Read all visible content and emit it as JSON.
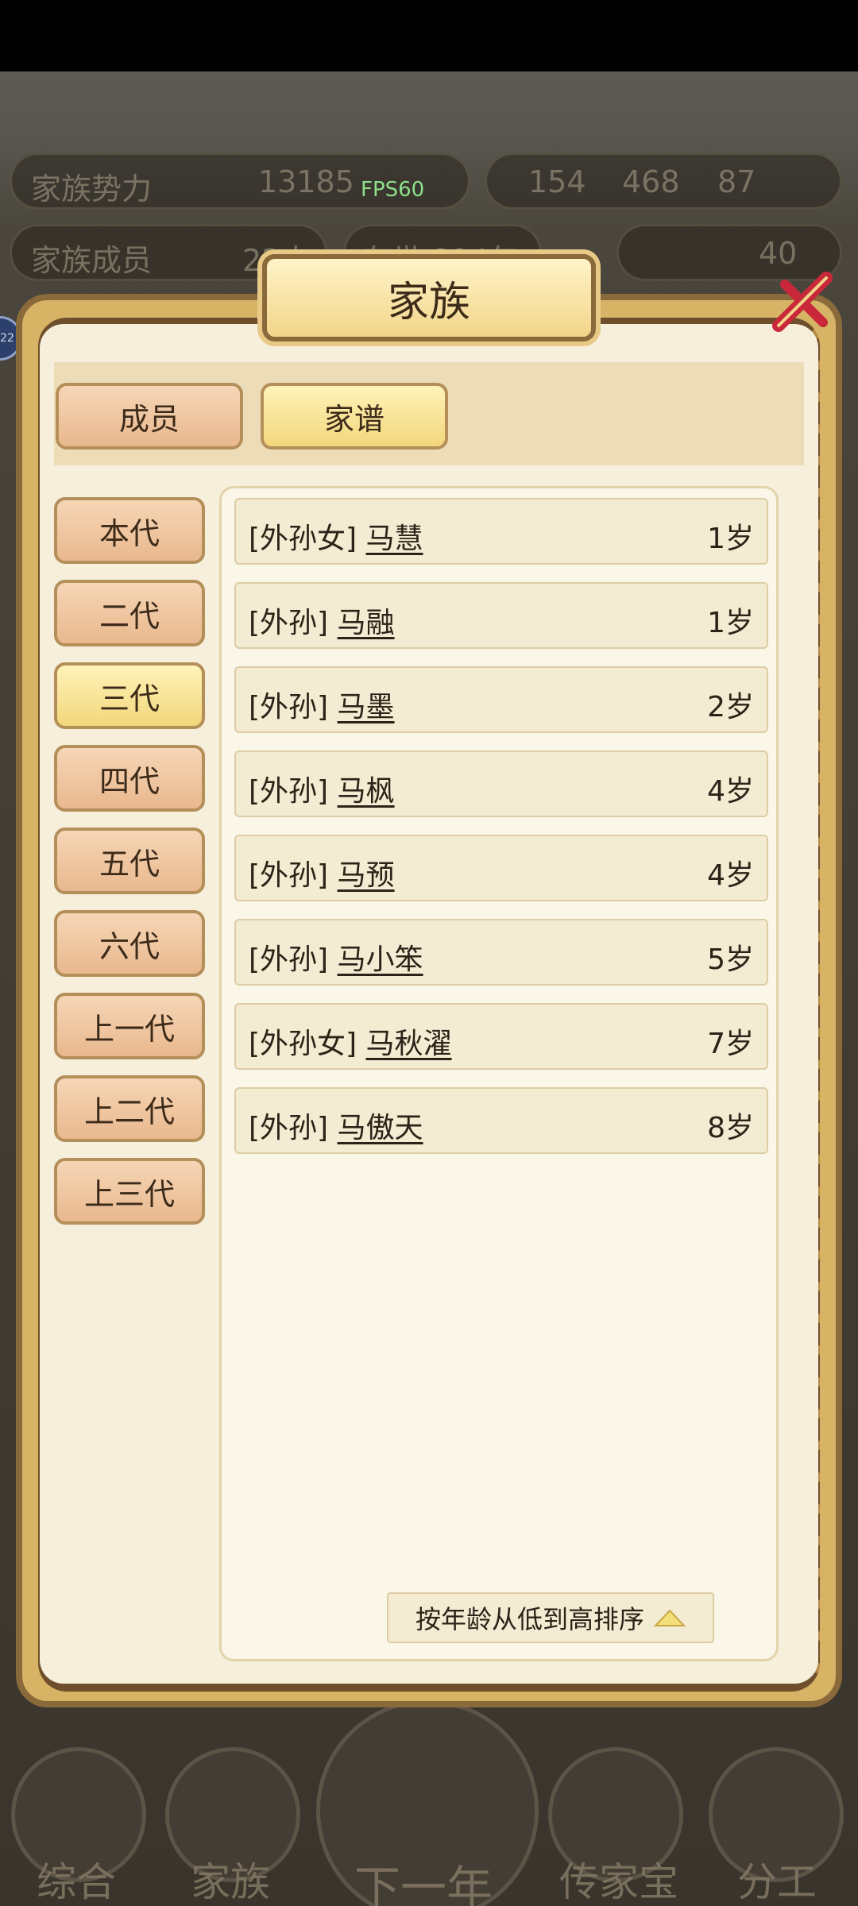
{
  "hud": {
    "power_label": "家族势力",
    "power_value": "13185",
    "members_label": "家族成员",
    "members_value": "22人",
    "exist_label": "存世",
    "exist_value": "894年",
    "resources": [
      "154",
      "468",
      "87"
    ],
    "gold_value": "40",
    "fps": "FPS60",
    "badge": "22"
  },
  "dialog": {
    "title": "家族",
    "tabs": [
      "成员",
      "家谱"
    ],
    "active_tab": "家谱",
    "generations": [
      "本代",
      "二代",
      "三代",
      "四代",
      "五代",
      "六代",
      "上一代",
      "上二代",
      "上三代"
    ],
    "active_generation": "三代",
    "members": [
      {
        "relation": "[外孙女]",
        "name": "马慧",
        "age": "1岁"
      },
      {
        "relation": "[外孙]",
        "name": "马融",
        "age": "1岁"
      },
      {
        "relation": "[外孙]",
        "name": "马墨",
        "age": "2岁"
      },
      {
        "relation": "[外孙]",
        "name": "马枫",
        "age": "4岁"
      },
      {
        "relation": "[外孙]",
        "name": "马预",
        "age": "4岁"
      },
      {
        "relation": "[外孙]",
        "name": "马小笨",
        "age": "5岁"
      },
      {
        "relation": "[外孙女]",
        "name": "马秋濯",
        "age": "7岁"
      },
      {
        "relation": "[外孙]",
        "name": "马傲天",
        "age": "8岁"
      }
    ],
    "sort_label": "按年龄从低到高排序"
  },
  "bottom_nav": [
    "综合",
    "家族",
    "下一年",
    "传家宝",
    "分工"
  ],
  "colors": {
    "panel": "#f6efdb",
    "frame": "#d7b465",
    "tab_active": "#f2d77c",
    "tab_inactive": "#e9b88e"
  }
}
